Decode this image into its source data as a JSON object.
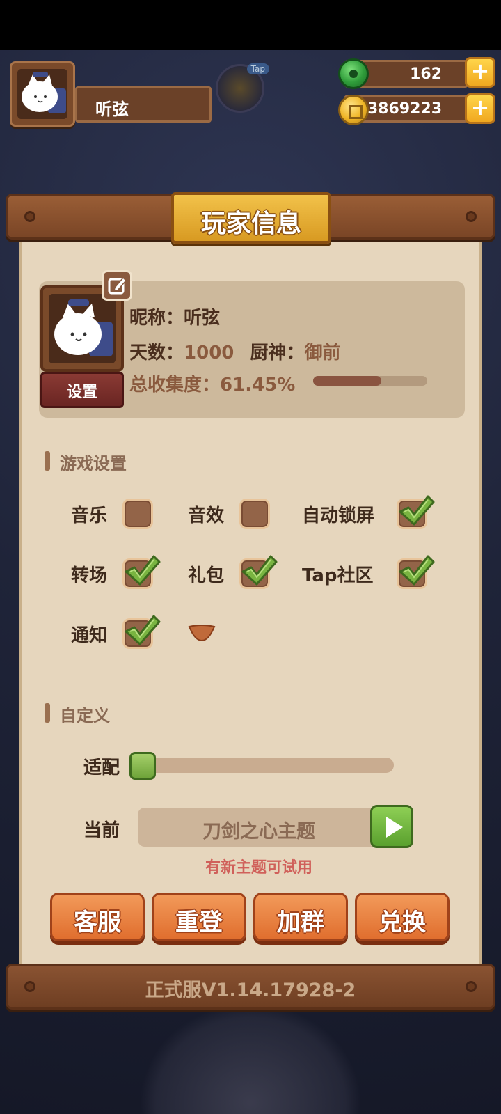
{
  "header": {
    "player_name": "听弦",
    "jade_count": "162",
    "coin_count": "3869223",
    "tap_tag": "Tap"
  },
  "panel": {
    "title": "玩家信息",
    "version": "正式服V1.14.17928-2"
  },
  "profile": {
    "nickname_label": "昵称：",
    "nickname": "听弦",
    "days_label": "天数：",
    "days": "1000",
    "chef_god_label": "厨神：",
    "chef_god": "御前",
    "collection_label": "总收集度：",
    "collection": "61.45%",
    "collection_progress": 0.6145,
    "settings_button": "设置"
  },
  "game_settings": {
    "title": "游戏设置",
    "options": [
      {
        "label": "音乐",
        "checked": false
      },
      {
        "label": "音效",
        "checked": false
      },
      {
        "label": "自动锁屏",
        "checked": true
      },
      {
        "label": "转场",
        "checked": true
      },
      {
        "label": "礼包",
        "checked": true
      },
      {
        "label": "Tap社区",
        "checked": true
      },
      {
        "label": "通知",
        "checked": true
      }
    ]
  },
  "custom": {
    "title": "自定义",
    "adapt_label": "适配",
    "adapt_value": 0,
    "current_label": "当前",
    "current_theme": "刀剑之心主题",
    "hint": "有新主题可试用"
  },
  "actions": [
    {
      "label": "客服"
    },
    {
      "label": "重登"
    },
    {
      "label": "加群"
    },
    {
      "label": "兑换"
    }
  ],
  "colors": {
    "accent_orange": "#e06e2e",
    "check_green": "#6fa43a",
    "paper": "#e6d6bd",
    "wood": "#7a4526"
  }
}
